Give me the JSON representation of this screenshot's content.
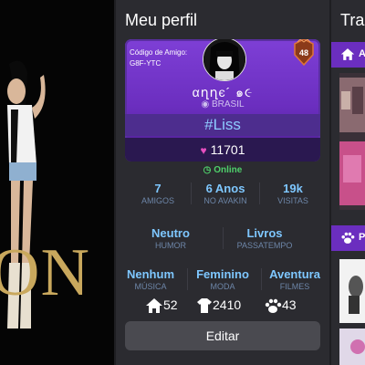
{
  "left": {
    "bg_text": "ON"
  },
  "profile": {
    "title": "Meu perfil",
    "friend_code_label": "Código de Amigo:",
    "friend_code": "G8F-YTC",
    "level": "48",
    "username": "αղղє´ ๑૯",
    "country": "BRASIL",
    "handle": "#Liss",
    "likes": "11701",
    "status": "Online",
    "stats_row1": [
      {
        "value": "7",
        "label": "AMIGOS"
      },
      {
        "value": "6 Anos",
        "label": "NO AVAKIN"
      },
      {
        "value": "19k",
        "label": "VISITAS"
      }
    ],
    "stats_row2": [
      {
        "value": "Neutro",
        "label": "HUMOR"
      },
      {
        "value": "Livros",
        "label": "PASSATEMPO"
      }
    ],
    "stats_row3": [
      {
        "value": "Nenhum",
        "label": "MÚSICA"
      },
      {
        "value": "Feminino",
        "label": "MODA"
      },
      {
        "value": "Aventura",
        "label": "FILMES"
      }
    ],
    "counts": {
      "homes": "52",
      "outfits": "2410",
      "pets": "43"
    },
    "edit_label": "Editar"
  },
  "right": {
    "title": "Tra",
    "tab1": "A",
    "tab2": "P"
  },
  "colors": {
    "accent": "#6b2ebf",
    "stat_value": "#7ec7ff",
    "online": "#4fd06b",
    "heart": "#e64fc0"
  }
}
